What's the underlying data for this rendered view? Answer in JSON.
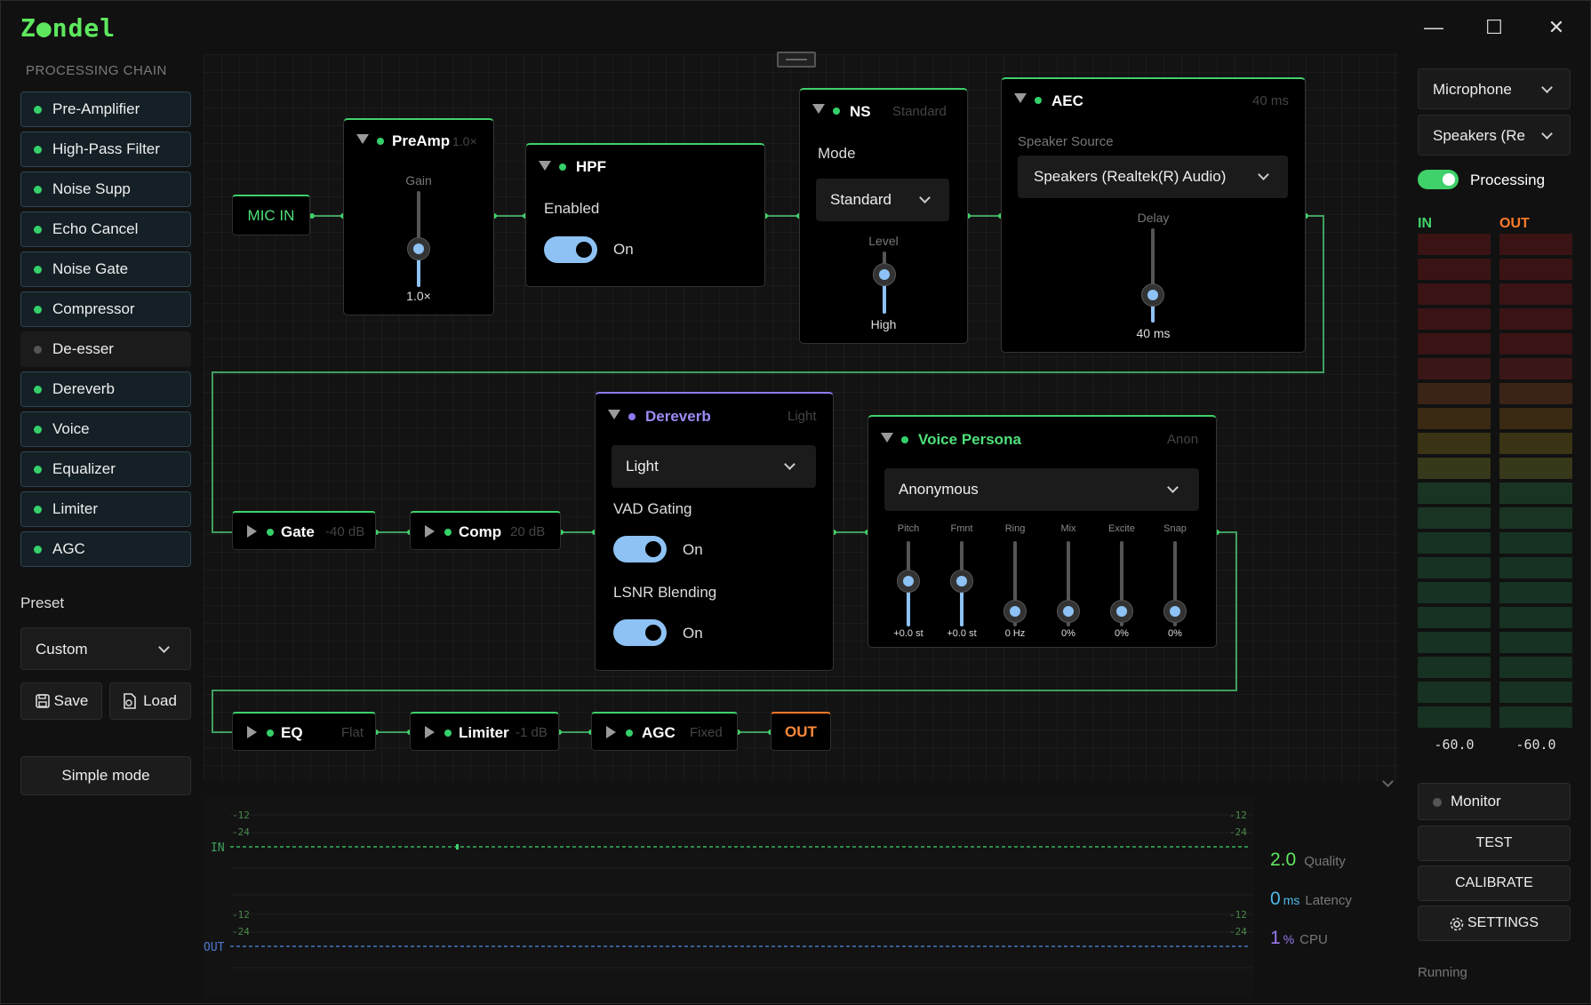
{
  "app": {
    "logo": "Z●ndel"
  },
  "window": {
    "minimize": "—",
    "maximize": "☐",
    "close": "✕"
  },
  "sidebar": {
    "section_title": "PROCESSING CHAIN",
    "items": [
      {
        "label": "Pre-Amplifier",
        "enabled": true
      },
      {
        "label": "High-Pass Filter",
        "enabled": true
      },
      {
        "label": "Noise Supp",
        "enabled": true
      },
      {
        "label": "Echo Cancel",
        "enabled": true
      },
      {
        "label": "Noise Gate",
        "enabled": true
      },
      {
        "label": "Compressor",
        "enabled": true
      },
      {
        "label": "De-esser",
        "enabled": false
      },
      {
        "label": "Dereverb",
        "enabled": true
      },
      {
        "label": "Voice",
        "enabled": true
      },
      {
        "label": "Equalizer",
        "enabled": true
      },
      {
        "label": "Limiter",
        "enabled": true
      },
      {
        "label": "AGC",
        "enabled": true
      }
    ],
    "preset_label": "Preset",
    "preset_value": "Custom",
    "save": "Save",
    "load": "Load",
    "simple_mode": "Simple mode"
  },
  "graph": {
    "mic_in": "MIC IN",
    "out": "OUT",
    "preamp": {
      "title": "PreAmp",
      "sub": "1.0×",
      "gain_label": "Gain",
      "gain_value": "1.0×",
      "gain_level": 0.4
    },
    "hpf": {
      "title": "HPF",
      "enabled_label": "Enabled",
      "state": "On"
    },
    "ns": {
      "title": "NS",
      "sub": "Standard",
      "mode_label": "Mode",
      "mode_value": "Standard",
      "level_label": "Level",
      "level_value": "High",
      "level_fraction": 0.8
    },
    "aec": {
      "title": "AEC",
      "sub": "40 ms",
      "source_label": "Speaker Source",
      "source_value": "Speakers (Realtek(R) Audio)",
      "delay_label": "Delay",
      "delay_value": "40 ms",
      "delay_fraction": 0.3
    },
    "gate": {
      "title": "Gate",
      "sub": "-40 dB"
    },
    "comp": {
      "title": "Comp",
      "sub": "20 dB"
    },
    "dereverb": {
      "title": "Dereverb",
      "sub": "Light",
      "mode_value": "Light",
      "vad_label": "VAD Gating",
      "vad_state": "On",
      "lsnr_label": "LSNR Blending",
      "lsnr_state": "On"
    },
    "voice": {
      "title": "Voice Persona",
      "sub": "Anon",
      "persona": "Anonymous",
      "sliders": [
        {
          "label": "Pitch",
          "value": "+0.0 st"
        },
        {
          "label": "Fmnt",
          "value": "+0.0 st"
        },
        {
          "label": "Ring",
          "value": "0 Hz"
        },
        {
          "label": "Mix",
          "value": "0%"
        },
        {
          "label": "Excite",
          "value": "0%"
        },
        {
          "label": "Snap",
          "value": "0%"
        }
      ]
    },
    "eq": {
      "title": "EQ",
      "sub": "Flat"
    },
    "limiter": {
      "title": "Limiter",
      "sub": "-1 dB"
    },
    "agc": {
      "title": "AGC",
      "sub": "Fixed"
    }
  },
  "scope": {
    "in_label": "IN",
    "out_label": "OUT",
    "ticks": [
      "-12",
      "-24"
    ],
    "stats": [
      {
        "value": "2.0",
        "unit": "",
        "label": "Quality",
        "color": "#5ee85e"
      },
      {
        "value": "0",
        "unit": "ms",
        "label": "Latency",
        "color": "#4fb8e8"
      },
      {
        "value": "1",
        "unit": "%",
        "label": "CPU",
        "color": "#9a7af0"
      }
    ]
  },
  "right": {
    "mic_device": "Microphone",
    "spk_device": "Speakers (Re",
    "processing_label": "Processing",
    "processing_on": true,
    "meter_in_label": "IN",
    "meter_out_label": "OUT",
    "meter_in_value": "-60.0",
    "meter_out_value": "-60.0",
    "monitor": "Monitor",
    "test": "TEST",
    "calibrate": "CALIBRATE",
    "settings": "SETTINGS",
    "status": "Running"
  },
  "colors": {
    "accent_green": "#3fd16a",
    "accent_blue": "#8ec2f4",
    "accent_purple": "#8b7bf0",
    "out_orange": "#ff8a3a"
  }
}
